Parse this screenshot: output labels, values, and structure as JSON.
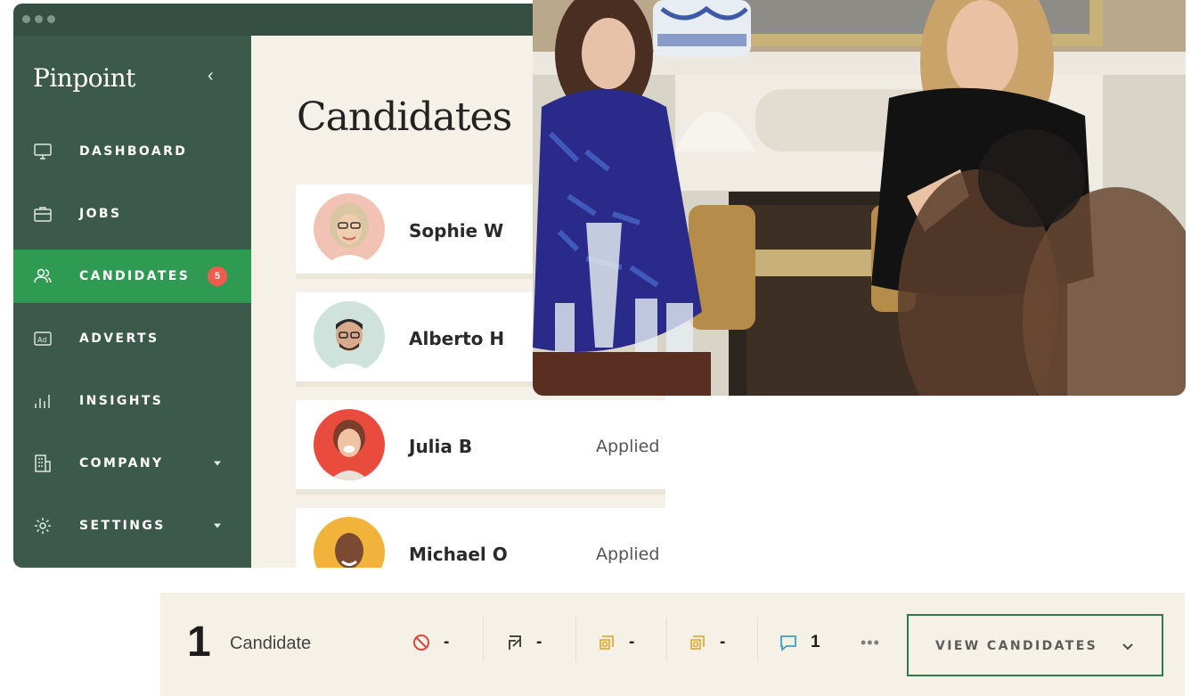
{
  "app": {
    "brand": "Pinpoint",
    "collapse_icon": "chevron-left-icon"
  },
  "sidebar": {
    "items": [
      {
        "label": "DASHBOARD",
        "icon": "monitor-icon"
      },
      {
        "label": "JOBS",
        "icon": "briefcase-icon"
      },
      {
        "label": "CANDIDATES",
        "icon": "users-icon",
        "badge": "5",
        "active": true
      },
      {
        "label": "ADVERTS",
        "icon": "ad-icon"
      },
      {
        "label": "INSIGHTS",
        "icon": "bar-chart-icon"
      },
      {
        "label": "COMPANY",
        "icon": "building-icon",
        "has_dropdown": true
      },
      {
        "label": "SETTINGS",
        "icon": "gear-icon",
        "has_dropdown": true
      }
    ]
  },
  "main": {
    "title": "Candidates",
    "candidates": [
      {
        "name": "Sophie W",
        "status": ""
      },
      {
        "name": "Alberto H",
        "status": ""
      },
      {
        "name": "Julia B",
        "status": "Applied"
      },
      {
        "name": "Michael O",
        "status": "Applied"
      }
    ]
  },
  "toolbar": {
    "count": "1",
    "count_label": "Candidate",
    "stats": [
      {
        "icon": "ban-icon",
        "value": "-",
        "color": "#e0443a"
      },
      {
        "icon": "share-icon",
        "value": "-",
        "color": "#333333"
      },
      {
        "icon": "review-yellow-icon",
        "value": "-",
        "color": "#e4ad3d"
      },
      {
        "icon": "review-orange-icon",
        "value": "-",
        "color": "#e4ad3d"
      },
      {
        "icon": "comment-icon",
        "value": "1",
        "color": "#3aa1c9"
      }
    ],
    "more": "•••",
    "view_button": "VIEW CANDIDATES"
  },
  "colors": {
    "sidebar": "#3c5a4b",
    "active": "#2f9a52",
    "badge": "#ef5b4c",
    "background": "#f5f1e8",
    "button_border": "#2f7a4d"
  }
}
